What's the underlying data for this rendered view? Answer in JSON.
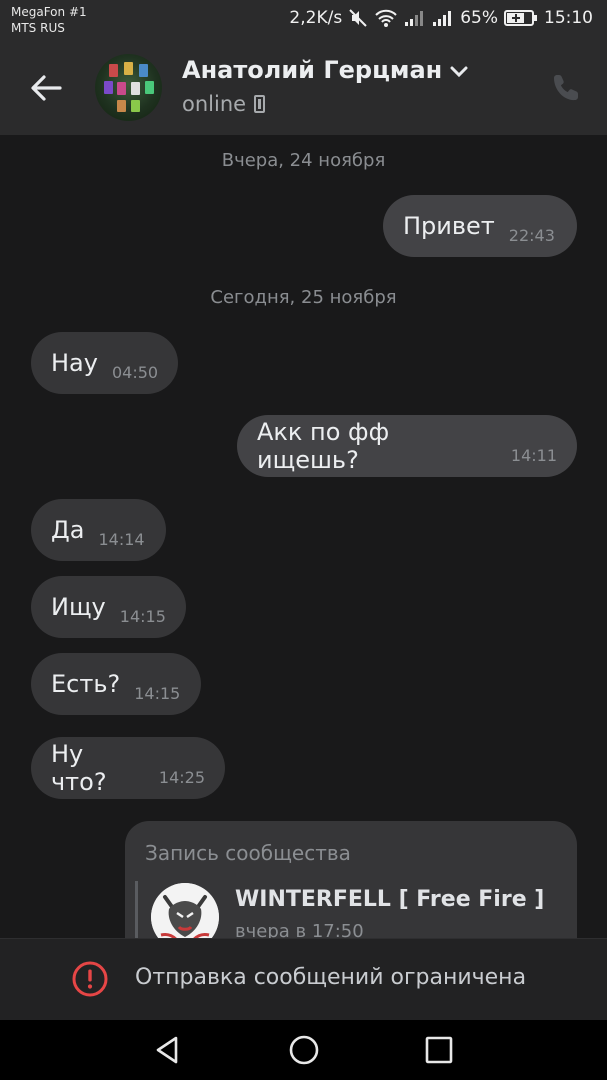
{
  "status_bar": {
    "carrier_line1": "MegaFon #1",
    "carrier_line2": "MTS RUS",
    "speed": "2,2K/s",
    "battery": "65%",
    "time": "15:10"
  },
  "header": {
    "name": "Анатолий Герцман",
    "status": "online"
  },
  "chat": {
    "date_yesterday": "Вчера, 24 ноября",
    "date_today": "Сегодня, 25 ноября",
    "messages": [
      {
        "dir": "out",
        "text": "Привет",
        "time": "22:43"
      },
      {
        "dir": "in",
        "text": "Нау",
        "time": "04:50"
      },
      {
        "dir": "out",
        "text": "Акк по фф ищешь?",
        "time": "14:11"
      },
      {
        "dir": "in",
        "text": "Да",
        "time": "14:14"
      },
      {
        "dir": "in",
        "text": "Ищу",
        "time": "14:15"
      },
      {
        "dir": "in",
        "text": "Есть?",
        "time": "14:15"
      },
      {
        "dir": "in",
        "text": "Ну что?",
        "time": "14:25"
      }
    ],
    "post": {
      "label": "Запись сообщества",
      "title": "WINTERFELL [ Free Fire ]",
      "subtitle": "вчера в 17:50"
    }
  },
  "restriction": {
    "text": "Отправка сообщений ограничена",
    "icon_color": "#e64646"
  },
  "icons": [
    "back-arrow-icon",
    "chevron-down-icon",
    "mobile-icon",
    "phone-icon",
    "warning-icon",
    "nav-back-icon",
    "nav-home-icon",
    "nav-recents-icon"
  ]
}
